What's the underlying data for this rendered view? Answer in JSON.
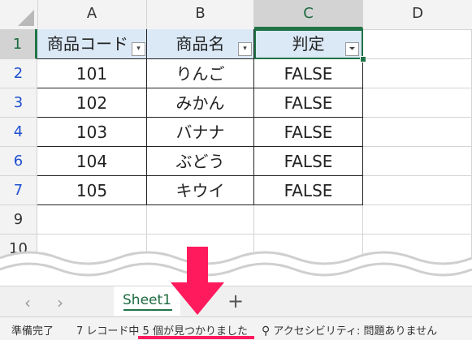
{
  "columns": [
    "A",
    "B",
    "C",
    "D"
  ],
  "rows": [
    "1",
    "2",
    "3",
    "4",
    "6",
    "7",
    "9",
    "10"
  ],
  "table": {
    "headers": [
      "商品コード",
      "商品名",
      "判定"
    ],
    "data": [
      [
        "101",
        "りんご",
        "FALSE"
      ],
      [
        "102",
        "みかん",
        "FALSE"
      ],
      [
        "103",
        "バナナ",
        "FALSE"
      ],
      [
        "104",
        "ぶどう",
        "FALSE"
      ],
      [
        "105",
        "キウイ",
        "FALSE"
      ]
    ]
  },
  "sheet": {
    "name": "Sheet1"
  },
  "status": {
    "ready": "準備完了",
    "records": "7 レコード中 5 個が見つかりました",
    "accessibility": "アクセシビリティ: 問題ありません"
  },
  "colors": {
    "accent": "#217346",
    "highlight": "#ff1a5e",
    "header_fill": "#dbe9f7",
    "filtered_row": "#1f4fd1"
  }
}
